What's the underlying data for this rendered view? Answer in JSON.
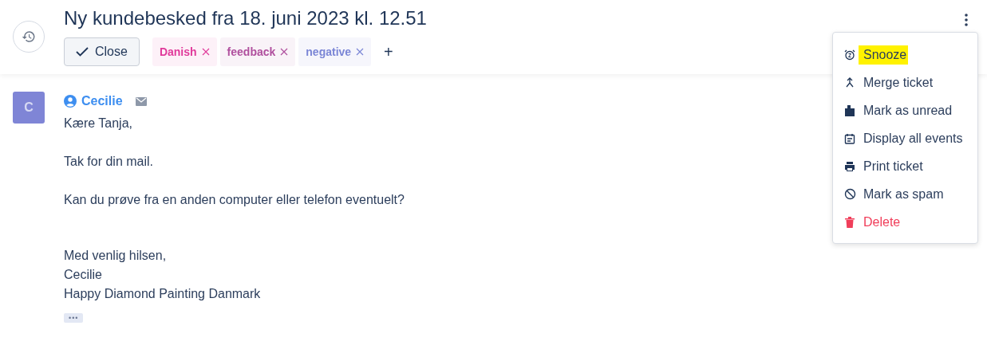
{
  "header": {
    "title": "Ny kundebesked fra 18. juni 2023 kl. 12.51",
    "close_button": "Close",
    "tags": [
      {
        "label": "Danish",
        "color": "#e0399a"
      },
      {
        "label": "feedback",
        "color": "#b0509e"
      },
      {
        "label": "negative",
        "color": "#7b86d6"
      }
    ],
    "add_tag": "+"
  },
  "menu": {
    "items": [
      {
        "label": "Snooze",
        "kind": "normal",
        "highlighted": true
      },
      {
        "label": "Merge ticket",
        "kind": "normal",
        "highlighted": false
      },
      {
        "label": "Mark as unread",
        "kind": "normal",
        "highlighted": false
      },
      {
        "label": "Display all events",
        "kind": "normal",
        "highlighted": false
      },
      {
        "label": "Print ticket",
        "kind": "normal",
        "highlighted": false
      },
      {
        "label": "Mark as spam",
        "kind": "normal",
        "highlighted": false
      },
      {
        "label": "Delete",
        "kind": "danger",
        "highlighted": false
      }
    ]
  },
  "message": {
    "avatar": "C",
    "sender": "Cecilie",
    "body": [
      [
        "Kære Tanja,"
      ],
      [
        "Tak for din mail."
      ],
      [
        "Kan du prøve fra en anden computer eller telefon eventuelt?"
      ],
      [
        "Med venlig hilsen,",
        "Cecilie",
        "Happy Diamond Painting Danmark"
      ]
    ],
    "more": "•••"
  }
}
